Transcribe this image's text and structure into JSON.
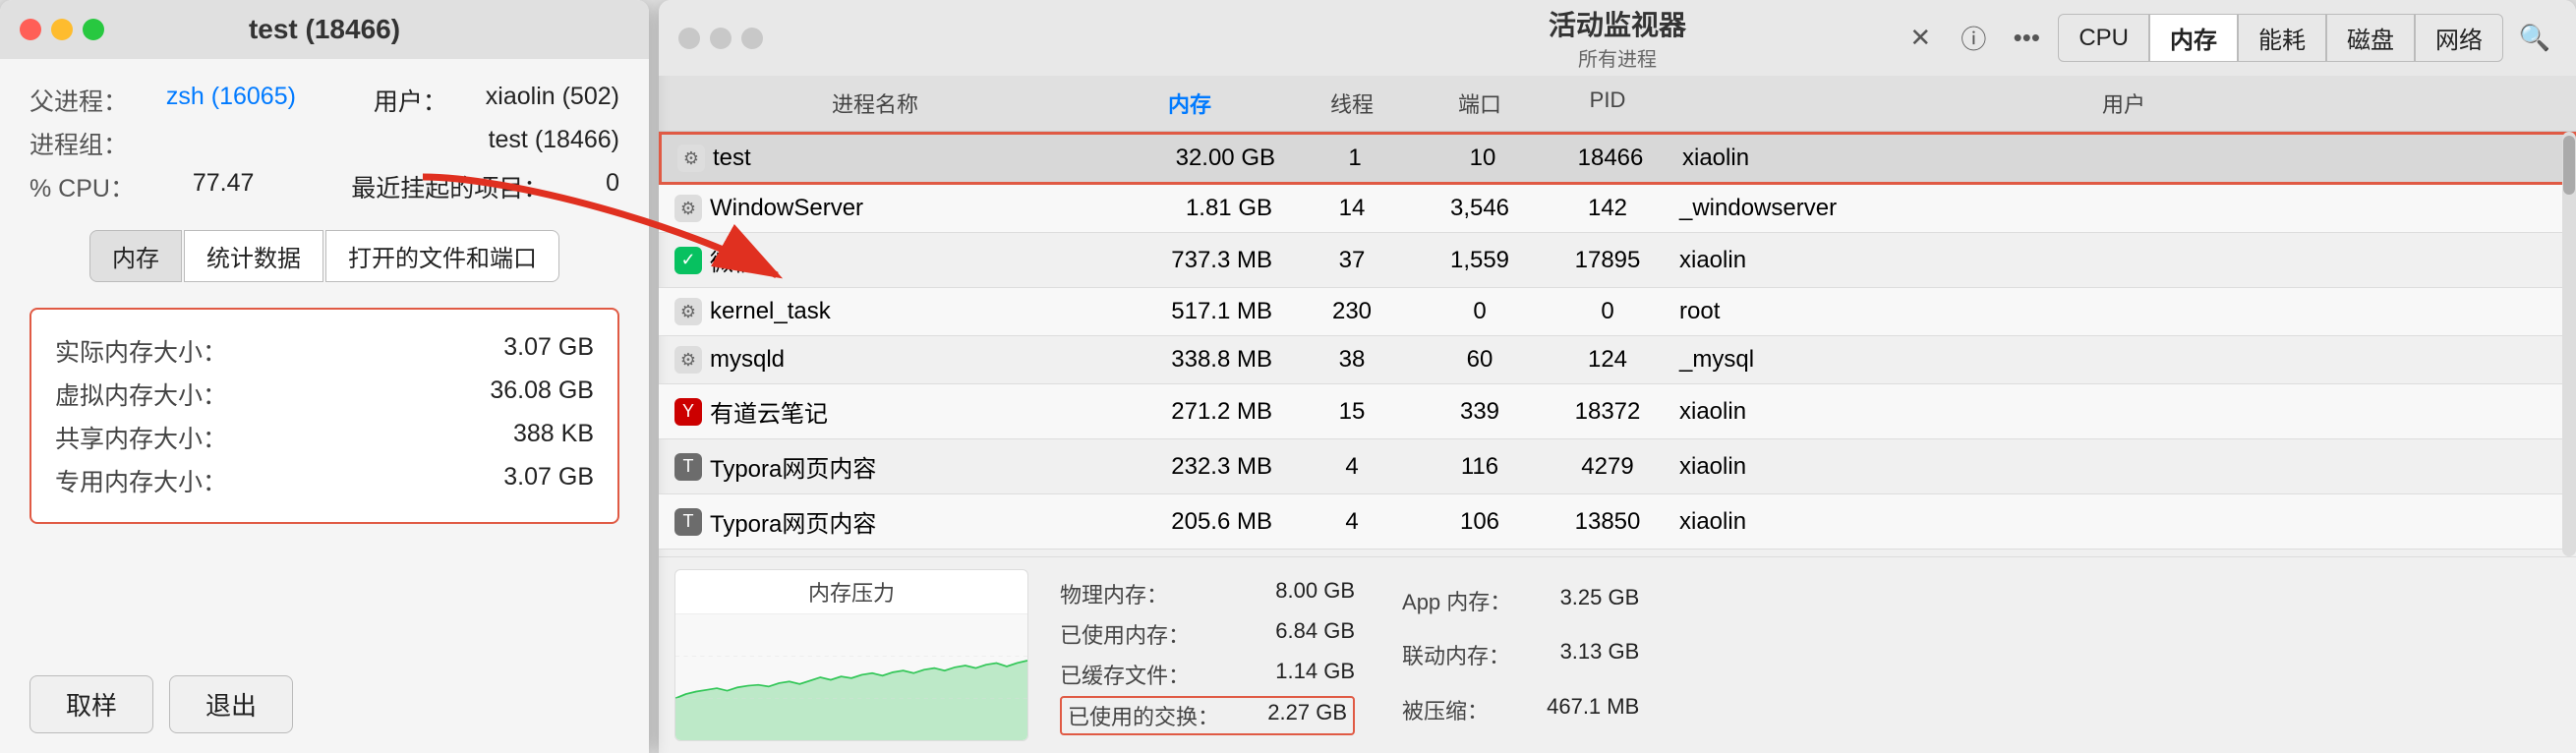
{
  "leftPanel": {
    "title": "test (18466)",
    "trafficLights": [
      "close",
      "minimize",
      "maximize"
    ],
    "infoRows": [
      {
        "label": "父进程：",
        "value": "zsh (16065)",
        "isLink": true
      },
      {
        "label": "进程组：",
        "value": "test (18466)",
        "isLink": false
      },
      {
        "label": "% CPU：",
        "value": "77.47",
        "isLink": false
      },
      {
        "label": "用户：",
        "value": "xiaolin (502)",
        "isLink": false
      },
      {
        "label": "最近挂起的项目：",
        "value": "0",
        "isLink": false
      }
    ],
    "tabs": [
      {
        "id": "memory",
        "label": "内存",
        "active": true
      },
      {
        "id": "stats",
        "label": "统计数据",
        "active": false
      },
      {
        "id": "files",
        "label": "打开的文件和端口",
        "active": false
      }
    ],
    "memoryDetails": [
      {
        "label": "实际内存大小：",
        "value": "3.07 GB"
      },
      {
        "label": "虚拟内存大小：",
        "value": "36.08 GB"
      },
      {
        "label": "共享内存大小：",
        "value": "388 KB"
      },
      {
        "label": "专用内存大小：",
        "value": "3.07 GB"
      }
    ],
    "buttons": [
      {
        "id": "sample",
        "label": "取样"
      },
      {
        "id": "quit",
        "label": "退出"
      }
    ]
  },
  "rightPanel": {
    "title": "活动监视器",
    "subtitle": "所有进程",
    "tabs": [
      {
        "id": "cpu",
        "label": "CPU"
      },
      {
        "id": "memory",
        "label": "内存",
        "active": true
      },
      {
        "id": "energy",
        "label": "能耗"
      },
      {
        "id": "disk",
        "label": "磁盘"
      },
      {
        "id": "network",
        "label": "网络"
      }
    ],
    "tableHeaders": [
      {
        "id": "process-name",
        "label": "进程名称"
      },
      {
        "id": "memory",
        "label": "内存"
      },
      {
        "id": "threads",
        "label": "线程"
      },
      {
        "id": "ports",
        "label": "端口"
      },
      {
        "id": "pid",
        "label": "PID"
      },
      {
        "id": "user",
        "label": "用户"
      }
    ],
    "tableRows": [
      {
        "name": "test",
        "icon": null,
        "memory": "32.00 GB",
        "threads": "1",
        "ports": "10",
        "pid": "18466",
        "user": "xiaolin",
        "highlighted": true
      },
      {
        "name": "WindowServer",
        "icon": null,
        "memory": "1.81 GB",
        "threads": "14",
        "ports": "3,546",
        "pid": "142",
        "user": "_windowserver"
      },
      {
        "name": "微信",
        "icon": "wechat",
        "memory": "737.3 MB",
        "threads": "37",
        "ports": "1,559",
        "pid": "17895",
        "user": "xiaolin"
      },
      {
        "name": "kernel_task",
        "icon": null,
        "memory": "517.1 MB",
        "threads": "230",
        "ports": "0",
        "pid": "0",
        "user": "root"
      },
      {
        "name": "mysqld",
        "icon": null,
        "memory": "338.8 MB",
        "threads": "38",
        "ports": "60",
        "pid": "124",
        "user": "_mysql"
      },
      {
        "name": "有道云笔记",
        "icon": "youdao",
        "memory": "271.2 MB",
        "threads": "15",
        "ports": "339",
        "pid": "18372",
        "user": "xiaolin"
      },
      {
        "name": "Typora网页内容",
        "icon": "typora",
        "memory": "232.3 MB",
        "threads": "4",
        "ports": "116",
        "pid": "4279",
        "user": "xiaolin"
      },
      {
        "name": "Typora网页内容",
        "icon": "typora",
        "memory": "205.6 MB",
        "threads": "4",
        "ports": "106",
        "pid": "13850",
        "user": "xiaolin"
      }
    ],
    "bottomStats": {
      "pressureTitle": "内存压力",
      "physicalMemory": {
        "label": "物理内存：",
        "value": "8.00 GB"
      },
      "usedMemory": {
        "label": "已使用内存：",
        "value": "6.84 GB"
      },
      "cachedFiles": {
        "label": "已缓存文件：",
        "value": "1.14 GB"
      },
      "swapUsed": {
        "label": "已使用的交换：",
        "value": "2.27 GB",
        "highlighted": true
      },
      "appMemory": {
        "label": "App 内存：",
        "value": "3.25 GB"
      },
      "wiredMemory": {
        "label": "联动内存：",
        "value": "3.13 GB"
      },
      "compressed": {
        "label": "被压缩：",
        "value": "467.1 MB"
      }
    }
  }
}
